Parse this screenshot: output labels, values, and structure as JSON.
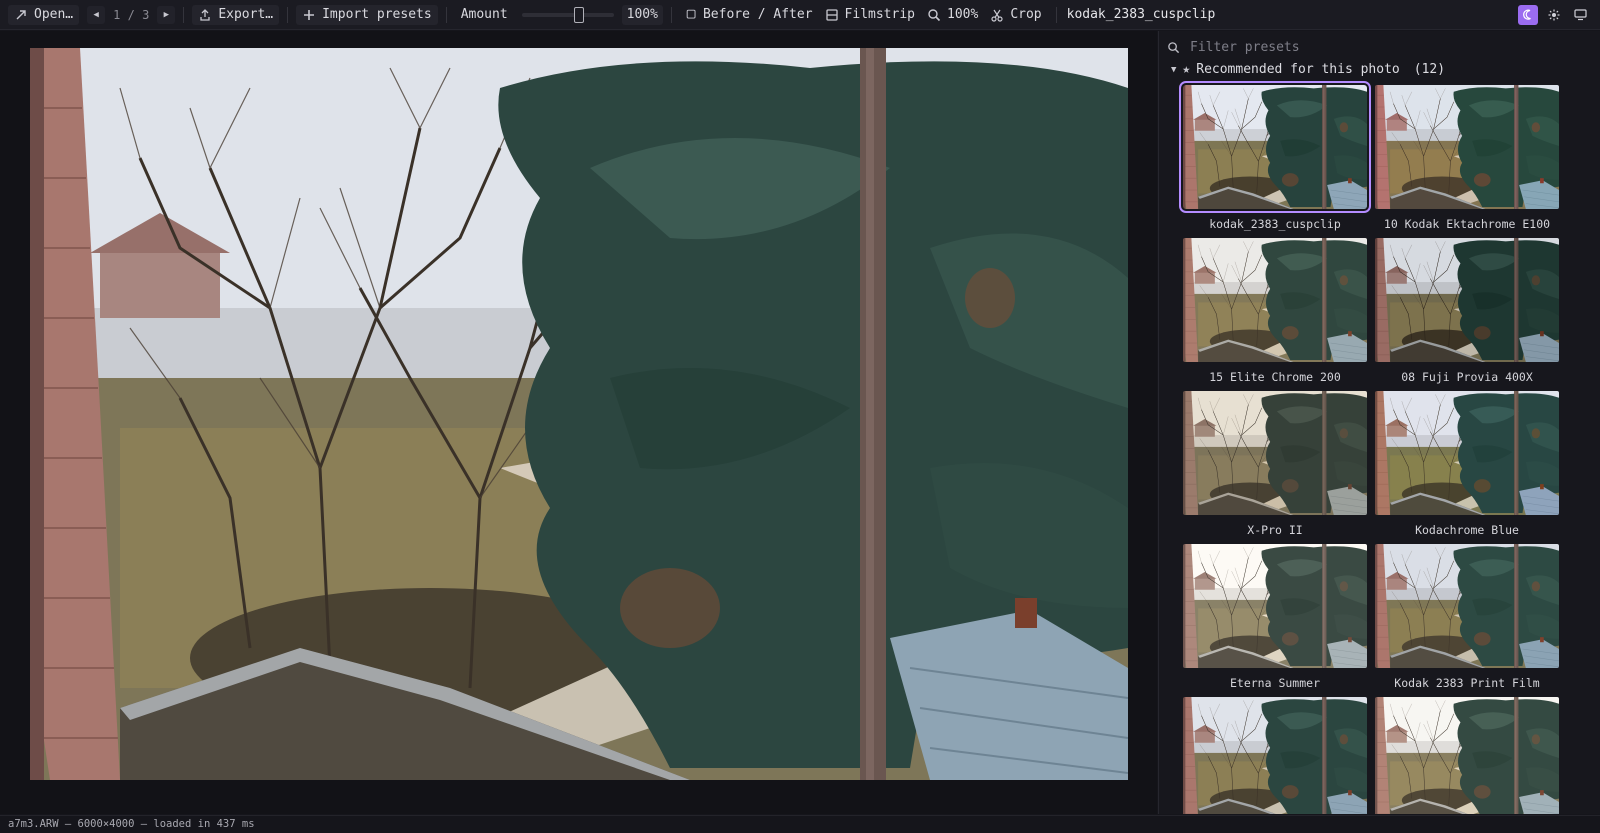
{
  "toolbar": {
    "open_label": "Open…",
    "page_current": "1",
    "page_sep": "/",
    "page_total": "3",
    "export_label": "Export…",
    "import_label": "Import presets",
    "amount_label": "Amount",
    "amount_value": 0.62,
    "amount_pct": "100%",
    "before_after_label": "Before / After",
    "filmstrip_label": "Filmstrip",
    "zoom_label": "100%",
    "crop_label": "Crop",
    "filename": "kodak_2383_cuspclip",
    "accent_color": "#9b6cf0"
  },
  "panel": {
    "filter_placeholder": "Filter presets",
    "section_title": "Recommended for this photo",
    "section_count": "(12)",
    "presets": [
      {
        "label": "kodak_2383_cuspclip",
        "selected": true
      },
      {
        "label": "10 Kodak Ektachrome E100",
        "selected": false
      },
      {
        "label": "15 Elite Chrome 200",
        "selected": false
      },
      {
        "label": "08 Fuji Provia 400X",
        "selected": false
      },
      {
        "label": "X-Pro II",
        "selected": false
      },
      {
        "label": "Kodachrome Blue",
        "selected": false
      },
      {
        "label": "Eterna Summer",
        "selected": false
      },
      {
        "label": "Kodak 2383 Print Film",
        "selected": false
      },
      {
        "label": "",
        "selected": false
      },
      {
        "label": "",
        "selected": false
      }
    ]
  },
  "status": {
    "text": "a7m3.ARW — 6000×4000 — loaded in 437 ms"
  }
}
